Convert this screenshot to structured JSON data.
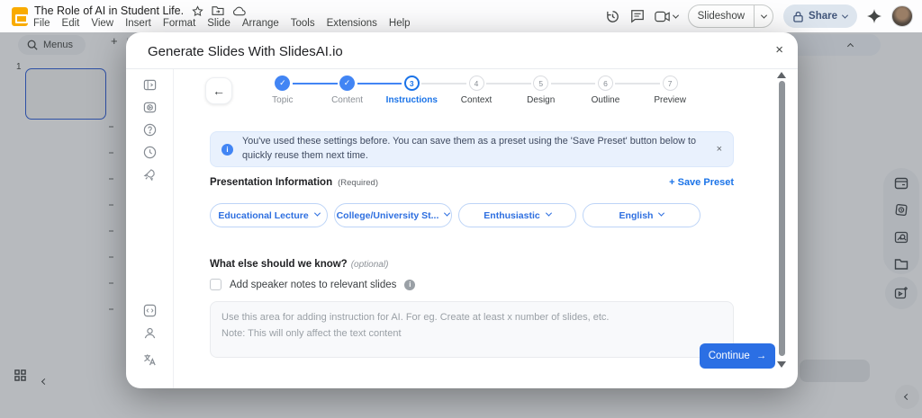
{
  "topbar": {
    "doc_title": "The Role of AI in Student Life.",
    "menus": [
      "File",
      "Edit",
      "View",
      "Insert",
      "Format",
      "Slide",
      "Arrange",
      "Tools",
      "Extensions",
      "Help"
    ],
    "slideshow_label": "Slideshow",
    "share_label": "Share"
  },
  "toolbar": {
    "menus_label": "Menus",
    "plus_glyph": "+",
    "undo_glyph": "↺",
    "redo_glyph": "↻"
  },
  "filmstrip": {
    "slide_number": "1"
  },
  "modal": {
    "title": "Generate Slides With SlidesAI.io",
    "close_glyph": "×",
    "back_glyph": "←",
    "check_glyph": "✓",
    "steps": [
      {
        "num": "1",
        "label": "Topic"
      },
      {
        "num": "2",
        "label": "Content"
      },
      {
        "num": "3",
        "label": "Instructions"
      },
      {
        "num": "4",
        "label": "Context"
      },
      {
        "num": "5",
        "label": "Design"
      },
      {
        "num": "6",
        "label": "Outline"
      },
      {
        "num": "7",
        "label": "Preview"
      }
    ],
    "banner_text": "You've used these settings before. You can save them as a preset using the 'Save Preset' button below to quickly reuse them next time.",
    "banner_close_glyph": "×",
    "info_glyph": "i",
    "section_title": "Presentation Information",
    "section_required": "(Required)",
    "save_preset_label": "+ Save Preset",
    "dropdowns": [
      "Educational Lecture",
      "College/University St...",
      "Enthusiastic",
      "English"
    ],
    "question_title": "What else should we know?",
    "question_optional": "(optional)",
    "checkbox_label": "Add speaker notes to relevant slides",
    "textarea_placeholder": "Use this area for adding instruction for AI. For eg. Create at least x number of slides, etc.\nNote: This will only affect the text content",
    "continue_label": "Continue",
    "continue_arrow": "→"
  },
  "colors": {
    "accent": "#1a73e8",
    "done_blue": "#4285f4",
    "continue_blue": "#2b6fe4",
    "banner_bg": "#e9f1fd"
  }
}
